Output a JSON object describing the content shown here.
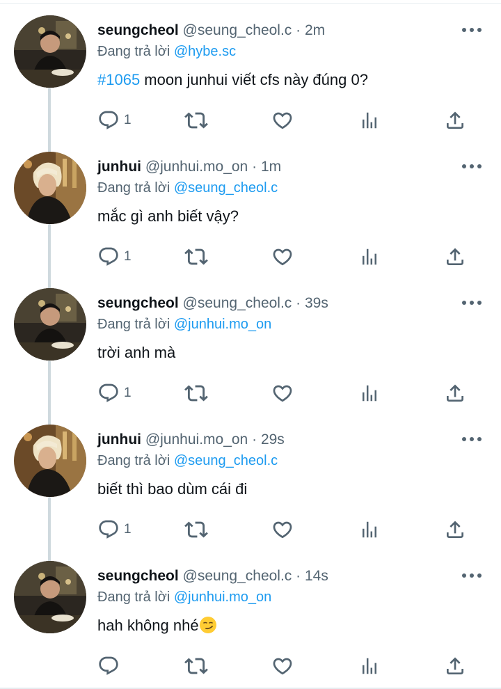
{
  "reply_prefix": "Đang trả lời",
  "colors": {
    "accent": "#1d9bf0",
    "muted": "#536471",
    "text": "#0f1419"
  },
  "tweets": [
    {
      "name": "seungcheol",
      "handle": "@seung_cheol.c",
      "time": "2m",
      "separator": "·",
      "reply_to": "@hybe.sc",
      "hashtag": "#1065",
      "text": " moon junhui viết cfs này đúng 0?",
      "reply_count": "1",
      "avatar_icon": "avatar-seungcheol"
    },
    {
      "name": "junhui",
      "handle": "@junhui.mo_on",
      "time": "1m",
      "separator": "·",
      "reply_to": "@seung_cheol.c",
      "hashtag": "",
      "text": "mắc gì anh biết vậy?",
      "reply_count": "1",
      "avatar_icon": "avatar-junhui"
    },
    {
      "name": "seungcheol",
      "handle": "@seung_cheol.c",
      "time": "39s",
      "separator": "·",
      "reply_to": "@junhui.mo_on",
      "hashtag": "",
      "text": "trời anh mà",
      "reply_count": "1",
      "avatar_icon": "avatar-seungcheol"
    },
    {
      "name": "junhui",
      "handle": "@junhui.mo_on",
      "time": "29s",
      "separator": "·",
      "reply_to": "@seung_cheol.c",
      "hashtag": "",
      "text": "biết thì bao dùm cái đi",
      "reply_count": "1",
      "avatar_icon": "avatar-junhui"
    },
    {
      "name": "seungcheol",
      "handle": "@seung_cheol.c",
      "time": "14s",
      "separator": "·",
      "reply_to": "@junhui.mo_on",
      "hashtag": "",
      "text": "hah không nhé",
      "emoji": "smirking-face-emoji",
      "reply_count": "",
      "avatar_icon": "avatar-seungcheol"
    }
  ]
}
